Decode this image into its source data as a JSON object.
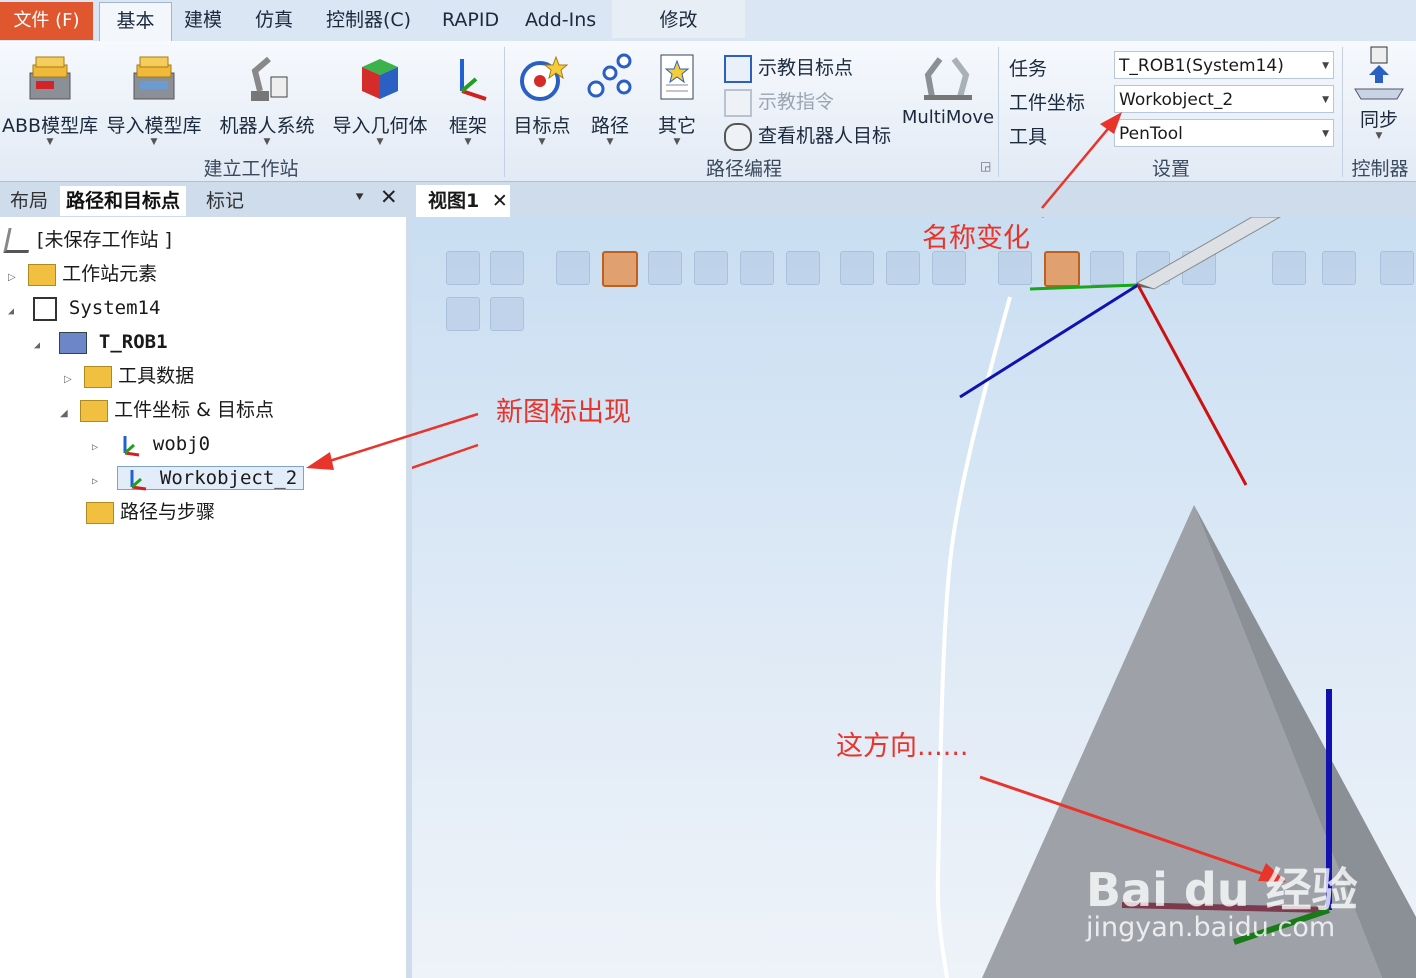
{
  "tabs": {
    "file": "文件 (F)",
    "basic": "基本",
    "modeling": "建模",
    "simulation": "仿真",
    "controller": "控制器(C)",
    "rapid": "RAPID",
    "addins": "Add-Ins",
    "modify": "修改"
  },
  "ribbon": {
    "build": {
      "abb_library": "ABB模型库",
      "import_library": "导入模型库",
      "robot_system": "机器人系统",
      "import_geometry": "导入几何体",
      "frame": "框架",
      "group_label": "建立工作站"
    },
    "path": {
      "target": "目标点",
      "path": "路径",
      "other": "其它",
      "teach_target": "示教目标点",
      "teach_instruction": "示教指令",
      "view_robot_target": "查看机器人目标",
      "multimove": "MultiMove",
      "group_label": "路径编程"
    },
    "settings": {
      "task_label": "任务",
      "task_value": "T_ROB1(System14)",
      "wobj_label": "工件坐标",
      "wobj_value": "Workobject_2",
      "tool_label": "工具",
      "tool_value": "PenTool",
      "group_label": "设置"
    },
    "controller": {
      "sync": "同步",
      "group_label": "控制器"
    }
  },
  "left_panel": {
    "tabs": [
      "布局",
      "路径和目标点",
      "标记"
    ],
    "tree": {
      "station": "[未保存工作站 ]",
      "station_elements": "工作站元素",
      "system": "System14",
      "task": "T_ROB1",
      "tool_data": "工具数据",
      "wobj_targets": "工件坐标 & 目标点",
      "wobj0": "wobj0",
      "wobj2": "Workobject_2",
      "paths": "路径与步骤"
    }
  },
  "view": {
    "tab": "视图1"
  },
  "annotations": {
    "name_change": "名称变化",
    "new_icon": "新图标出现",
    "direction": "这方向......"
  },
  "watermark": {
    "brand": "Bai du 经验",
    "url": "jingyan.baidu.com"
  },
  "colors": {
    "file_tab": "#e0562e",
    "annotation": "#e8342a",
    "axis_x": "#cc1111",
    "axis_y": "#1aa61a",
    "axis_z": "#1111b0"
  }
}
